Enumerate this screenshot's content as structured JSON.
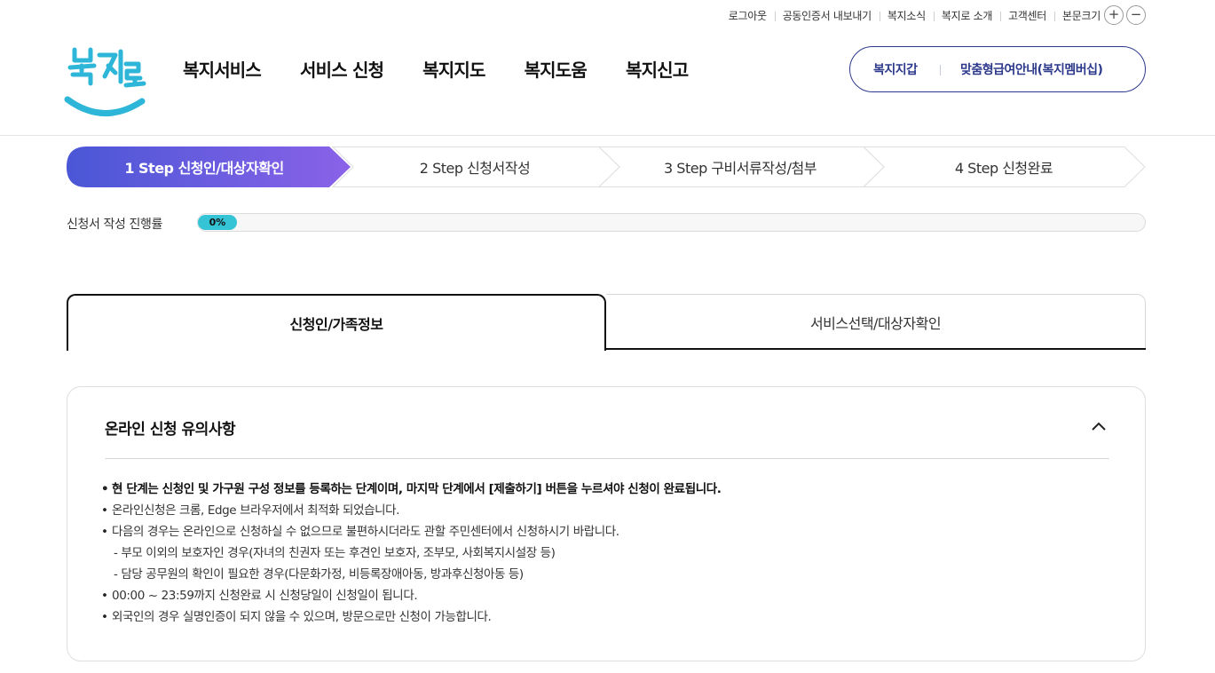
{
  "utility": {
    "links": [
      "로그아웃",
      "공동인증서 내보내기",
      "복지소식",
      "복지로 소개",
      "고객센터",
      "본문크기"
    ],
    "plus": "+",
    "minus": "−"
  },
  "logo": {
    "text": "복지로"
  },
  "gnb": [
    "복지서비스",
    "서비스 신청",
    "복지지도",
    "복지도움",
    "복지신고"
  ],
  "member": {
    "wallet": "복지지갑",
    "custom": "맞춤형급여안내(복지멤버십)"
  },
  "steps": [
    {
      "label": "1 Step 신청인/대상자확인",
      "active": true
    },
    {
      "label": "2 Step 신청서작성",
      "active": false
    },
    {
      "label": "3 Step 구비서류작성/첨부",
      "active": false
    },
    {
      "label": "4 Step 신청완료",
      "active": false
    }
  ],
  "progress": {
    "label": "신청서 작성 진행률",
    "value": "0%",
    "percent": 0
  },
  "tabs": {
    "active": "신청인/가족정보",
    "inactive": "서비스선택/대상자확인"
  },
  "notice": {
    "title": "온라인 신청 유의사항",
    "items": [
      {
        "text": "현 단계는 신청인 및 가구원 구성 정보를 등록하는 단계이며, 마지막 단계에서 [제출하기] 버튼을 누르셔야 신청이 완료됩니다.",
        "type": "bullet",
        "bold": true
      },
      {
        "text": "온라인신청은 크롬, Edge 브라우저에서 최적화 되었습니다.",
        "type": "bullet"
      },
      {
        "text": "다음의 경우는 온라인으로 신청하실 수 없으므로 불편하시더라도 관할 주민센터에서 신청하시기 바랍니다.",
        "type": "bullet"
      },
      {
        "text": "- 부모 이외의 보호자인 경우(자녀의 친권자 또는 후견인 보호자, 조부모, 사회복지시설장 등)",
        "type": "dash"
      },
      {
        "text": "- 담당 공무원의 확인이 필요한 경우(다문화가정, 비등록장애아동, 방과후신청아동 등)",
        "type": "dash"
      },
      {
        "text": "00:00 ~ 23:59까지 신청완료 시 신청당일이 신청일이 됩니다.",
        "type": "bullet"
      },
      {
        "text": "외국인의 경우 실명인증이 되지 않을 수 있으며, 방문으로만 신청이 가능합니다.",
        "type": "bullet"
      }
    ]
  },
  "colors": {
    "accent": "#2d3a8c",
    "step_gradient_start": "#4a57d6",
    "step_gradient_end": "#8a62e8",
    "progress": "#35c3d6",
    "logo": "#2db6d8"
  }
}
